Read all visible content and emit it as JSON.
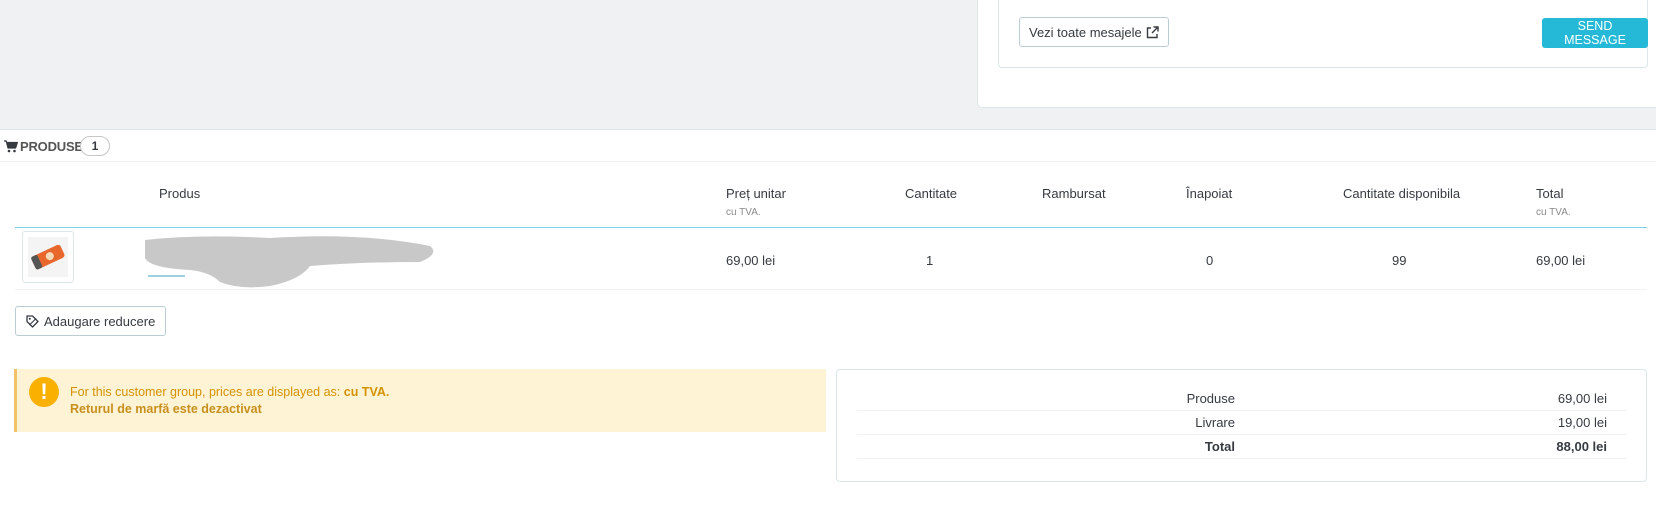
{
  "messages": {
    "view_all_label": "Vezi toate mesajele",
    "send_label": "SEND MESSAGE"
  },
  "products_panel": {
    "title": "PRODUSE",
    "count": "1"
  },
  "table": {
    "headers": {
      "product": "Produs",
      "unit_price": "Preț unitar",
      "unit_price_sub": "cu TVA.",
      "quantity": "Cantitate",
      "refunded": "Rambursat",
      "returned": "Înapoiat",
      "available": "Cantitate disponibila",
      "total": "Total",
      "total_sub": "cu TVA."
    },
    "rows": [
      {
        "unit_price": "69,00 lei",
        "quantity": "1",
        "refunded": "",
        "returned": "0",
        "available": "99",
        "total": "69,00 lei"
      }
    ]
  },
  "discount_button_label": "Adaugare reducere",
  "alert": {
    "text": "For this customer group, prices are displayed as:",
    "emphasis": "cu TVA.",
    "returns": "Returul de marfă este dezactivat"
  },
  "summary": {
    "rows": [
      {
        "label": "Produse",
        "value": "69,00 lei"
      },
      {
        "label": "Livrare",
        "value": "19,00 lei"
      },
      {
        "label": "Total",
        "value": "88,00 lei"
      }
    ]
  },
  "colors": {
    "accent": "#25b9d7",
    "warning": "#fab000",
    "warning_bg": "#fff3d6"
  },
  "icons": {
    "cart": "shopping-cart-icon",
    "external": "external-link-icon",
    "discount": "tag-icon",
    "warning": "exclamation-icon"
  }
}
